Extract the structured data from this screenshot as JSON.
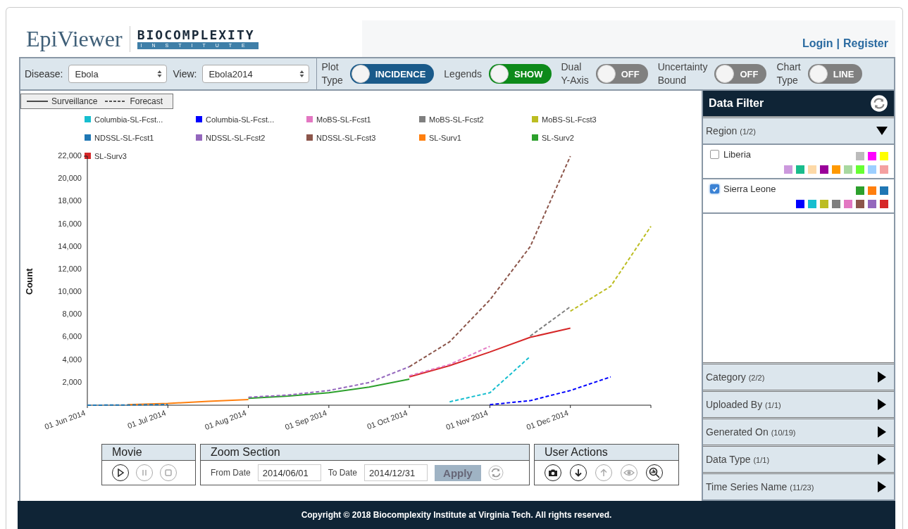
{
  "header": {
    "app_name": "EpiViewer",
    "logo_top": "BIOCOMPLEXITY",
    "logo_bottom": "INSTITUTE",
    "login": "Login",
    "separator": "|",
    "register": "Register"
  },
  "toolbar": {
    "selects": [
      {
        "label": "Disease:",
        "value": "Ebola"
      },
      {
        "label": "View:",
        "value": "Ebola2014"
      }
    ],
    "toggles": [
      {
        "label": "Plot Type",
        "value": "INCIDENCE",
        "color": "#1a5a8a"
      },
      {
        "label": "Legends",
        "value": "SHOW",
        "color": "#0d8a1a"
      },
      {
        "label": "Dual Y-Axis",
        "value": "OFF",
        "color": "#808080"
      },
      {
        "label": "Uncertainty Bound",
        "value": "OFF",
        "color": "#808080"
      },
      {
        "label": "Chart Type",
        "value": "LINE",
        "color": "#808080"
      }
    ]
  },
  "line_legend": [
    {
      "label": "Surveillance",
      "kind": "solid"
    },
    {
      "label": "Forecast",
      "kind": "dashed"
    }
  ],
  "chart": {
    "chart_data": {
      "type": "line",
      "legend": "top",
      "ylabel": "Count",
      "categories": [
        "01 Jun 2014",
        null,
        "01 Jul 2014",
        null,
        "01 Aug 2014",
        null,
        "01 Sep 2014",
        null,
        "01 Oct 2014",
        null,
        "01 Nov 2014",
        null,
        "01 Dec 2014",
        null,
        null
      ],
      "ylim": [
        0,
        22000
      ],
      "yticks": [
        {
          "value": 2000,
          "label": "2,000"
        },
        {
          "value": 4000,
          "label": "4,000"
        },
        {
          "value": 6000,
          "label": "6,000"
        },
        {
          "value": 8000,
          "label": "8,000"
        },
        {
          "value": 10000,
          "label": "10,000"
        },
        {
          "value": 12000,
          "label": "12,000"
        },
        {
          "value": 14000,
          "label": "14,000"
        },
        {
          "value": 16000,
          "label": "16,000"
        },
        {
          "value": 18000,
          "label": "18,000"
        },
        {
          "value": 20000,
          "label": "20,000"
        },
        {
          "value": 22000,
          "label": "22,000"
        }
      ],
      "series": [
        {
          "name": "Columbia-SL-Fcst...",
          "color": "#17becf",
          "line_style": "dashed",
          "values": [
            null,
            null,
            null,
            null,
            null,
            null,
            null,
            null,
            null,
            300,
            1100,
            4300,
            null,
            null,
            null
          ]
        },
        {
          "name": "Columbia-SL-Fcst...",
          "color": "#0000ff",
          "line_style": "dashed",
          "values": [
            null,
            null,
            null,
            null,
            null,
            null,
            null,
            null,
            null,
            null,
            50,
            400,
            1300,
            2500,
            null
          ]
        },
        {
          "name": "MoBS-SL-Fcst1",
          "color": "#e377c2",
          "line_style": "dashed",
          "values": [
            null,
            null,
            null,
            null,
            null,
            null,
            null,
            null,
            2600,
            3600,
            5200,
            null,
            null,
            null,
            null
          ]
        },
        {
          "name": "MoBS-SL-Fcst2",
          "color": "#7f7f7f",
          "line_style": "dashed",
          "values": [
            null,
            null,
            null,
            null,
            null,
            null,
            null,
            null,
            null,
            null,
            null,
            6100,
            8700,
            null,
            null
          ]
        },
        {
          "name": "MoBS-SL-Fcst3",
          "color": "#bcbd22",
          "line_style": "dashed",
          "values": [
            null,
            null,
            null,
            null,
            null,
            null,
            null,
            null,
            null,
            null,
            null,
            null,
            8300,
            10500,
            15800
          ]
        },
        {
          "name": "NDSSL-SL-Fcst1",
          "color": "#1f77b4",
          "line_style": "dashed",
          "values": [
            0,
            20,
            60,
            null,
            null,
            null,
            null,
            null,
            null,
            null,
            null,
            null,
            null,
            null,
            null
          ]
        },
        {
          "name": "NDSSL-SL-Fcst2",
          "color": "#9467bd",
          "line_style": "dashed",
          "values": [
            null,
            null,
            null,
            null,
            700,
            900,
            1300,
            2000,
            3400,
            null,
            null,
            null,
            null,
            null,
            null
          ]
        },
        {
          "name": "NDSSL-SL-Fcst3",
          "color": "#8c564b",
          "line_style": "dashed",
          "values": [
            null,
            null,
            null,
            null,
            null,
            null,
            null,
            null,
            3400,
            5600,
            9300,
            14000,
            22000,
            null,
            null
          ]
        },
        {
          "name": "SL-Surv1",
          "color": "#ff7f0e",
          "line_style": "solid",
          "values": [
            null,
            50,
            150,
            350,
            500,
            null,
            null,
            null,
            null,
            null,
            null,
            null,
            null,
            null,
            null
          ]
        },
        {
          "name": "SL-Surv2",
          "color": "#2ca02c",
          "line_style": "solid",
          "values": [
            null,
            null,
            null,
            null,
            600,
            800,
            1100,
            1600,
            2300,
            null,
            null,
            null,
            null,
            null,
            null
          ]
        },
        {
          "name": "SL-Surv3",
          "color": "#d62728",
          "line_style": "solid",
          "values": [
            null,
            null,
            null,
            null,
            null,
            null,
            null,
            null,
            2500,
            3500,
            4700,
            6000,
            6800,
            null,
            null
          ]
        }
      ]
    }
  },
  "movie": {
    "title": "Movie",
    "buttons": [
      {
        "kind": "play",
        "disabled": false
      },
      {
        "kind": "pause",
        "disabled": true
      },
      {
        "kind": "stop",
        "disabled": true
      }
    ]
  },
  "zoom_section": {
    "title": "Zoom Section",
    "from_label": "From Date",
    "from_value": "2014/06/01",
    "to_label": "To Date",
    "to_value": "2014/12/31",
    "apply": "Apply"
  },
  "user_actions": {
    "title": "User Actions",
    "buttons": [
      {
        "kind": "camera",
        "disabled": false
      },
      {
        "kind": "download",
        "disabled": false
      },
      {
        "kind": "upload",
        "disabled": true
      },
      {
        "kind": "eye",
        "disabled": true
      },
      {
        "kind": "chart-zoom",
        "disabled": false
      }
    ]
  },
  "data_filter": {
    "title": "Data Filter",
    "sections": [
      {
        "label": "Region",
        "count": "(1/2)",
        "expanded": true,
        "items": [
          {
            "label": "Liberia",
            "checked": false,
            "swatch_rows": [
              [
                {
                  "color": "#bbbbbb"
                },
                {
                  "color": "#ff00ff"
                },
                {
                  "color": "#ffff00"
                }
              ],
              [
                {
                  "color": "#cc99dd"
                },
                {
                  "color": "#1abc8c"
                },
                {
                  "color": "#fdd9a7"
                },
                {
                  "color": "#990099"
                },
                {
                  "color": "#ff9900"
                },
                {
                  "color": "#a8d8a0"
                },
                {
                  "color": "#66ff33"
                },
                {
                  "color": "#9ccfff"
                },
                {
                  "color": "#f4a0a0"
                }
              ]
            ]
          },
          {
            "label": "Sierra Leone",
            "checked": true,
            "swatch_rows": [
              [
                {
                  "color": "#2ca02c"
                },
                {
                  "color": "#ff7f0e"
                },
                {
                  "color": "#1f77b4"
                }
              ],
              [
                {
                  "color": "#0000ff"
                },
                {
                  "color": "#17becf"
                },
                {
                  "color": "#bcbd22"
                },
                {
                  "color": "#7f7f7f"
                },
                {
                  "color": "#e377c2"
                },
                {
                  "color": "#8c564b"
                },
                {
                  "color": "#9467bd"
                },
                {
                  "color": "#d62728"
                }
              ]
            ]
          }
        ]
      },
      {
        "label": "Category",
        "count": "(2/2)",
        "expanded": false
      },
      {
        "label": "Uploaded By",
        "count": "(1/1)",
        "expanded": false
      },
      {
        "label": "Generated On",
        "count": "(10/19)",
        "expanded": false
      },
      {
        "label": "Data Type",
        "count": "(1/1)",
        "expanded": false
      },
      {
        "label": "Time Series Name",
        "count": "(11/23)",
        "expanded": false
      }
    ]
  },
  "footer": {
    "copyright": "Copyright © 2018 Biocomplexity Institute at Virginia Tech. All rights reserved."
  }
}
